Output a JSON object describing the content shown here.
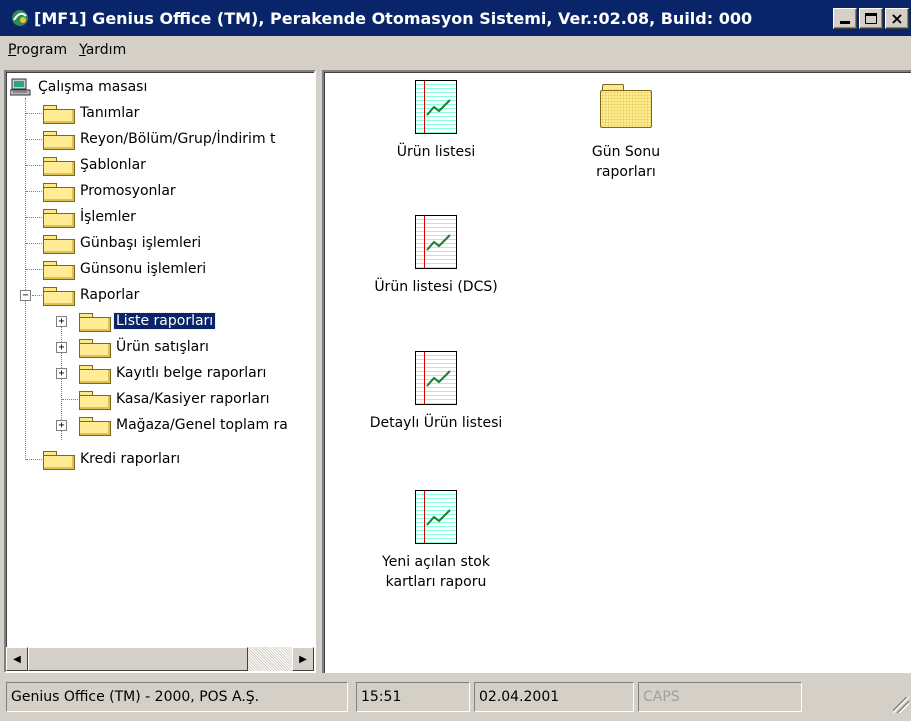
{
  "window": {
    "title": "[MF1] Genius Office (TM), Perakende Otomasyon Sistemi, Ver.:02.08, Build: 000"
  },
  "menu": [
    {
      "label": "Program",
      "underline": "P",
      "rest": "rogram"
    },
    {
      "label": "Yardım",
      "underline": "Y",
      "rest": "ardım"
    }
  ],
  "tree": {
    "root": "Çalışma masası",
    "items": [
      "Tanımlar",
      "Reyon/Bölüm/Grup/İndirim t",
      "Şablonlar",
      "Promosyonlar",
      "İşlemler",
      "Günbaşı işlemleri",
      "Günsonu işlemleri",
      "Raporlar"
    ],
    "raporlar_children": [
      "Liste raporları",
      "Ürün satışları",
      "Kayıtlı belge raporları",
      "Kasa/Kasiyer raporları",
      "Mağaza/Genel toplam ra"
    ],
    "last": "Kredi raporları",
    "selected": "Liste raporları"
  },
  "content": {
    "items": [
      {
        "label_line1": "Ürün listesi",
        "label_line2": "",
        "kind": "report"
      },
      {
        "label_line1": "Gün Sonu",
        "label_line2": "raporları",
        "kind": "folder"
      },
      {
        "label_line1": "Ürün listesi (DCS)",
        "label_line2": "",
        "kind": "report"
      },
      {
        "label_line1": "Detaylı Ürün listesi",
        "label_line2": "",
        "kind": "report"
      },
      {
        "label_line1": "Yeni açılan stok",
        "label_line2": "kartları raporu",
        "kind": "report"
      }
    ]
  },
  "status": {
    "company": "Genius Office (TM) - 2000, POS A.Ş.",
    "time": "15:51",
    "date": "02.04.2001",
    "caps": "CAPS"
  }
}
